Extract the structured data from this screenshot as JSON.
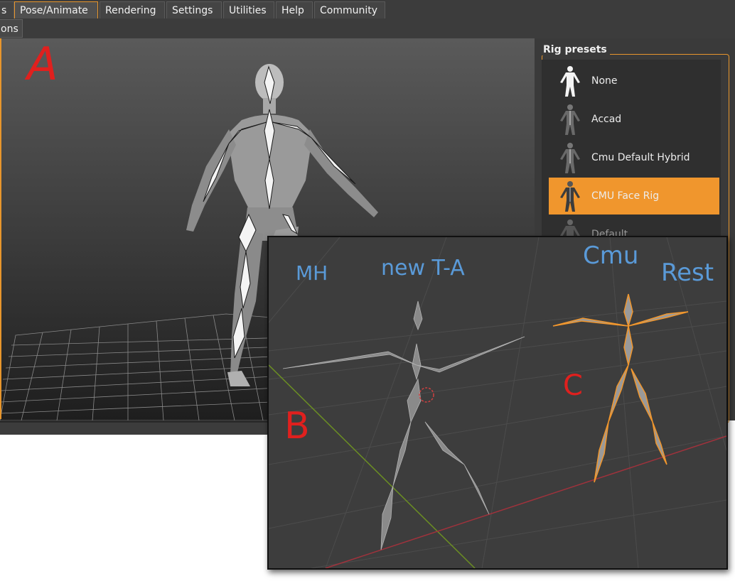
{
  "menubar": {
    "tabs": [
      {
        "label": "s"
      },
      {
        "label": "Pose/Animate",
        "active": true
      },
      {
        "label": "Rendering"
      },
      {
        "label": "Settings"
      },
      {
        "label": "Utilities"
      },
      {
        "label": "Help"
      },
      {
        "label": "Community"
      }
    ]
  },
  "subbar": {
    "tab_label": "ons"
  },
  "rig_panel": {
    "title": "Rig presets",
    "presets": [
      {
        "label": "None",
        "icon": "white-figure-icon"
      },
      {
        "label": "Accad",
        "icon": "skeleton-figure-icon"
      },
      {
        "label": "Cmu Default Hybrid",
        "icon": "skeleton-figure-icon"
      },
      {
        "label": "CMU Face Rig",
        "icon": "skeleton-figure-icon",
        "selected": true
      },
      {
        "label": "Default",
        "icon": "skeleton-figure-icon"
      }
    ]
  },
  "annotations": {
    "a": "A",
    "b": "B",
    "c": "C",
    "mh": "MH",
    "new_ta": "new T-A",
    "cmu": "Cmu",
    "rest": "Rest"
  },
  "colors": {
    "accent": "#f0962d",
    "annotation_red": "#e0201e",
    "annotation_blue": "#5a9ad8",
    "rig_orange": "#f0962d"
  }
}
